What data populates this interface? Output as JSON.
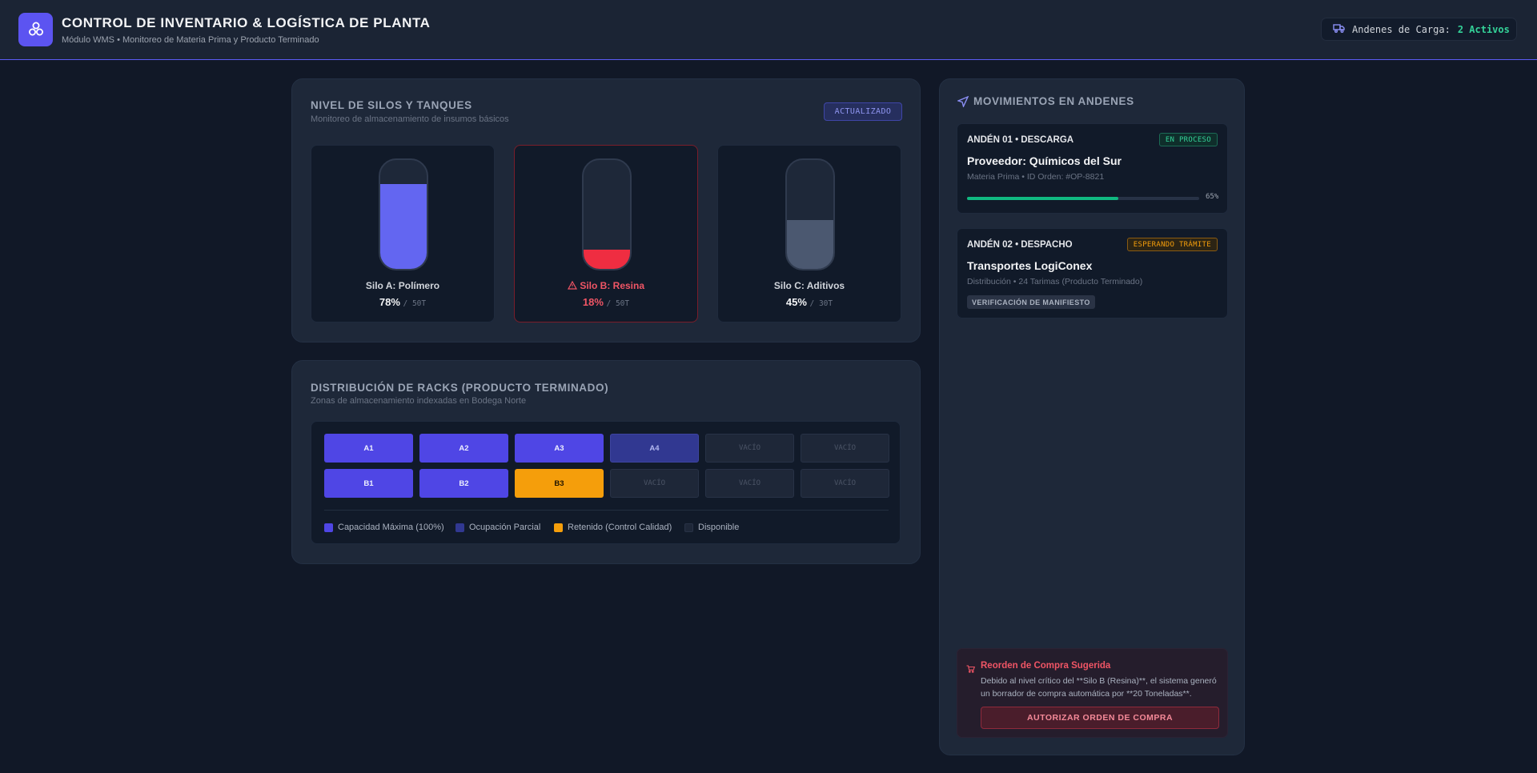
{
  "header": {
    "title": "CONTROL DE INVENTARIO & LOGÍSTICA DE PLANTA",
    "subtitle": "Módulo WMS • Monitoreo de Materia Prima y Producto Terminado",
    "docks_label": "Andenes de Carga:",
    "docks_value": "2 Activos",
    "logo_icon": "boxes-icon",
    "dock_icon": "truck-icon"
  },
  "silos": {
    "title": "NIVEL DE SILOS Y TANQUES",
    "subtitle": "Monitoreo de almacenamiento de insumos básicos",
    "badge": "ACTUALIZADO",
    "items": [
      {
        "name": "Silo A: Polímero",
        "pct": "78%",
        "cap": "/ 50T",
        "level": 0.78,
        "color": "#6366f1",
        "state": "normal"
      },
      {
        "name": "Silo B: Resina",
        "pct": "18%",
        "cap": "/ 50T",
        "level": 0.18,
        "color": "#ef2d41",
        "state": "critical",
        "icon": "warning-triangle-icon"
      },
      {
        "name": "Silo C: Aditivos",
        "pct": "45%",
        "cap": "/ 30T",
        "level": 0.45,
        "color": "#4b5870",
        "state": "normal"
      }
    ]
  },
  "racks": {
    "title": "DISTRIBUCIÓN DE RACKS (PRODUCTO TERMINADO)",
    "subtitle": "Zonas de almacenamiento indexadas en Bodega Norte",
    "row1": [
      {
        "label": "A1",
        "state": "full"
      },
      {
        "label": "A2",
        "state": "full"
      },
      {
        "label": "A3",
        "state": "full"
      },
      {
        "label": "A4",
        "state": "partial"
      },
      {
        "label": "VACÍO",
        "state": "empty"
      },
      {
        "label": "VACÍO",
        "state": "empty"
      }
    ],
    "row2": [
      {
        "label": "B1",
        "state": "full"
      },
      {
        "label": "B2",
        "state": "full"
      },
      {
        "label": "B3",
        "state": "held"
      },
      {
        "label": "VACÍO",
        "state": "empty"
      },
      {
        "label": "VACÍO",
        "state": "empty"
      },
      {
        "label": "VACÍO",
        "state": "empty"
      }
    ],
    "legend": {
      "full": "Capacidad Máxima (100%)",
      "partial": "Ocupación Parcial",
      "held": "Retenido (Control Calidad)",
      "empty": "Disponible"
    },
    "legend_colors": {
      "full": "#4f46e5",
      "partial": "#313891",
      "held": "#f59e0b",
      "empty": "#1e2738"
    }
  },
  "movements": {
    "title": "MOVIMIENTOS EN ANDENES",
    "title_icon": "navigation-arrow-icon",
    "cards": [
      {
        "head": "ANDÉN 01 • DESCARGA",
        "badge": "EN PROCESO",
        "name": "Proveedor: Químicos del Sur",
        "meta": "Materia Prima • ID Orden: #OP-8821",
        "progress": 0.65,
        "progress_label": "65%"
      },
      {
        "head": "ANDÉN 02 • DESPACHO",
        "badge": "ESPERANDO TRÁMITE",
        "name": "Transportes LogiConex",
        "meta": "Distribución • 24 Tarimas (Producto Terminado)",
        "chip": "VERIFICACIÓN DE MANIFIESTO"
      }
    ]
  },
  "alert": {
    "icon": "cart-icon",
    "title": "Reorden de Compra Sugerida",
    "body": "Debido al nivel crítico del **Silo B (Resina)**, el sistema generó un borrador de compra automática por **20 Toneladas**.",
    "button": "AUTORIZAR ORDEN DE COMPRA"
  }
}
